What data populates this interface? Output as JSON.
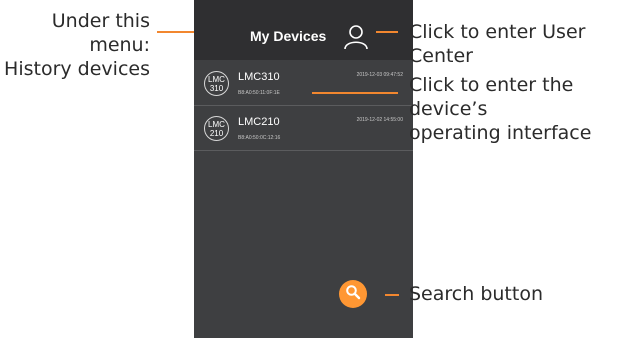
{
  "app": {
    "header_title": "My Devices"
  },
  "devices": [
    {
      "avatar_line1": "LMC",
      "avatar_line2": "310",
      "name": "LMC310",
      "mac": "B8:A0:50:11:0F:1E",
      "timestamp": "2019-12-03 09:47:52"
    },
    {
      "avatar_line1": "LMC",
      "avatar_line2": "210",
      "name": "LMC210",
      "mac": "B8:A0:50:0C:12:16",
      "timestamp": "2019-12-02 14:55:00"
    }
  ],
  "annotations": {
    "history_line1": "Under this menu:",
    "history_line2": "History devices",
    "user_center": "Click to enter User Center",
    "device_interface_line1": "Click to enter the device’s",
    "device_interface_line2": "operating interface",
    "search": "Search button"
  },
  "icons": {
    "user": "user-icon",
    "search": "search-icon"
  },
  "colors": {
    "phone_background": "#3e3f41",
    "header_background": "#2f2f31",
    "accent": "#ff9733",
    "callout_line": "#f2872f"
  }
}
